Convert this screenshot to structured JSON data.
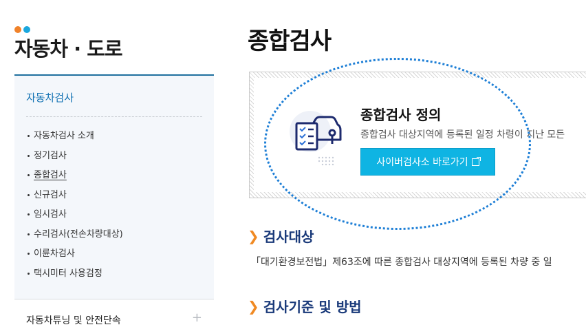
{
  "section": {
    "title": "자동차 · 도로"
  },
  "sidebar": {
    "heading": "자동차검사",
    "items": [
      {
        "label": "자동차검사 소개"
      },
      {
        "label": "정기검사"
      },
      {
        "label": "종합검사"
      },
      {
        "label": "신규검사"
      },
      {
        "label": "임시검사"
      },
      {
        "label": "수리검사(전손차량대상)"
      },
      {
        "label": "이륜차검사"
      },
      {
        "label": "택시미터 사용검정"
      }
    ],
    "next_menu": {
      "label": "자동차튜닝 및 안전단속",
      "icon": "plus-icon"
    }
  },
  "main": {
    "title": "종합검사",
    "definition": {
      "title": "종합검사 정의",
      "desc": "종합검사 대상지역에 등록된 일정 차령이 지난 모든",
      "button_label": "사이버검사소 바로가기",
      "icon": "car-checklist-icon"
    },
    "sections": [
      {
        "heading": "검사대상",
        "text": "「대기환경보전법」제63조에 따른 종합검사 대상지역에 등록된 차량 중 일"
      },
      {
        "heading": "검사기준 및 방법"
      }
    ]
  },
  "colors": {
    "accent": "#0fb4e3",
    "heading_navy": "#1a3a7a",
    "sidebar_link": "#1473b4",
    "dot_orange": "#f0822a",
    "dot_blue": "#1aa7de"
  }
}
